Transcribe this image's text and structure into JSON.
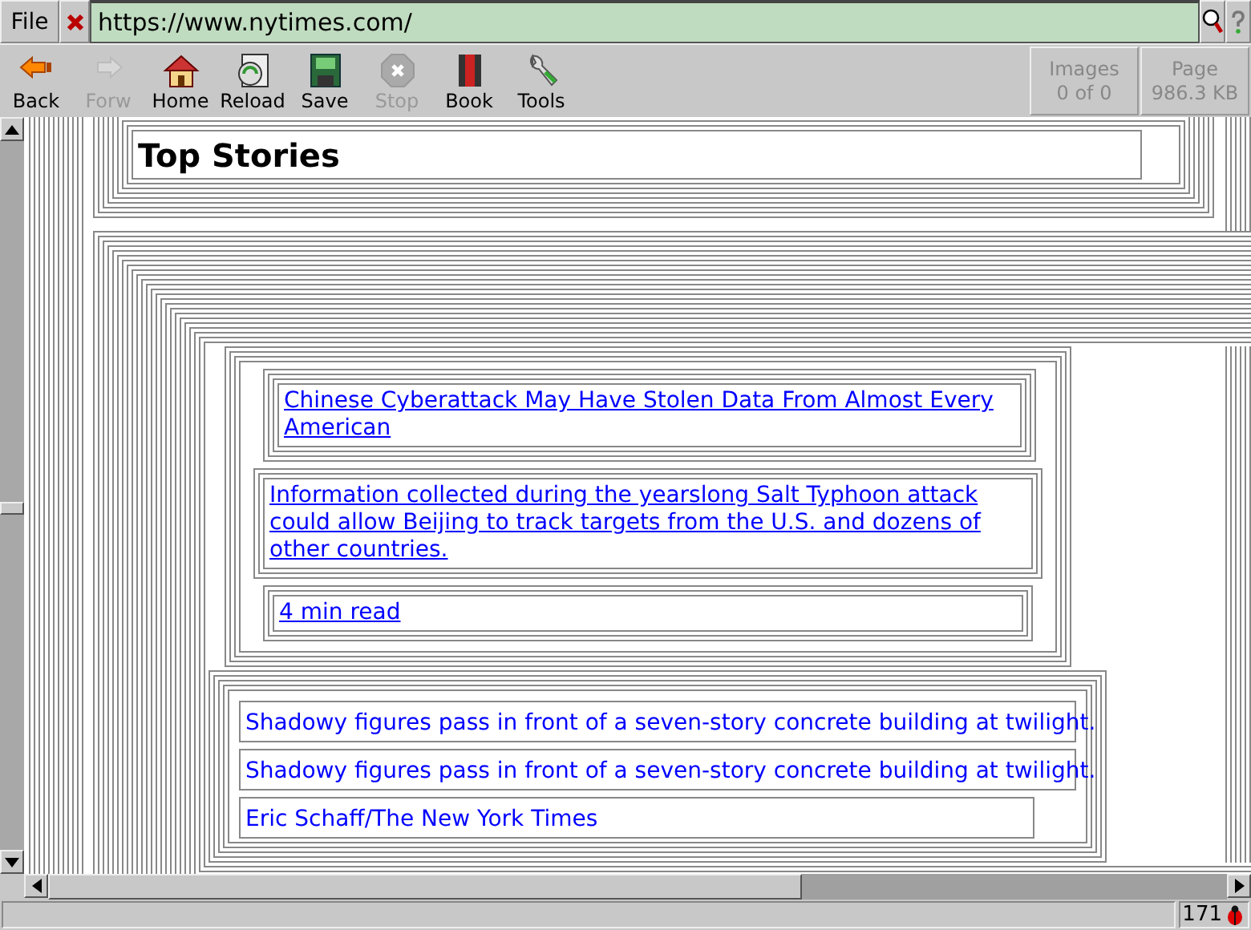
{
  "menu": {
    "file": "File"
  },
  "url": "https://www.nytimes.com/",
  "toolbar": [
    {
      "label": "Back",
      "kind": "back",
      "disabled": false
    },
    {
      "label": "Forw",
      "kind": "forward",
      "disabled": true
    },
    {
      "label": "Home",
      "kind": "home",
      "disabled": false
    },
    {
      "label": "Reload",
      "kind": "reload",
      "disabled": false
    },
    {
      "label": "Save",
      "kind": "save",
      "disabled": false
    },
    {
      "label": "Stop",
      "kind": "stop",
      "disabled": true
    },
    {
      "label": "Book",
      "kind": "book",
      "disabled": false
    },
    {
      "label": "Tools",
      "kind": "tools",
      "disabled": false
    }
  ],
  "info_panels": [
    {
      "title": "Images",
      "value": "0 of 0"
    },
    {
      "title": "Page",
      "value": "986.3 KB"
    }
  ],
  "page": {
    "heading": "Top Stories",
    "story": {
      "headline": "Chinese Cyberattack May Have Stolen Data From Almost Every American",
      "summary": "Information collected during the yearslong Salt Typhoon attack could allow Beijing to track targets from the U.S. and dozens of other countries.",
      "read_time": "4 min read"
    },
    "captions": [
      "Shadowy figures pass in front of a seven-story concrete building at twilight.",
      "Shadowy figures pass in front of a seven-story concrete building at twilight."
    ],
    "credit": "Eric Schaff/The New York Times"
  },
  "status_bar": {
    "count": "171"
  }
}
